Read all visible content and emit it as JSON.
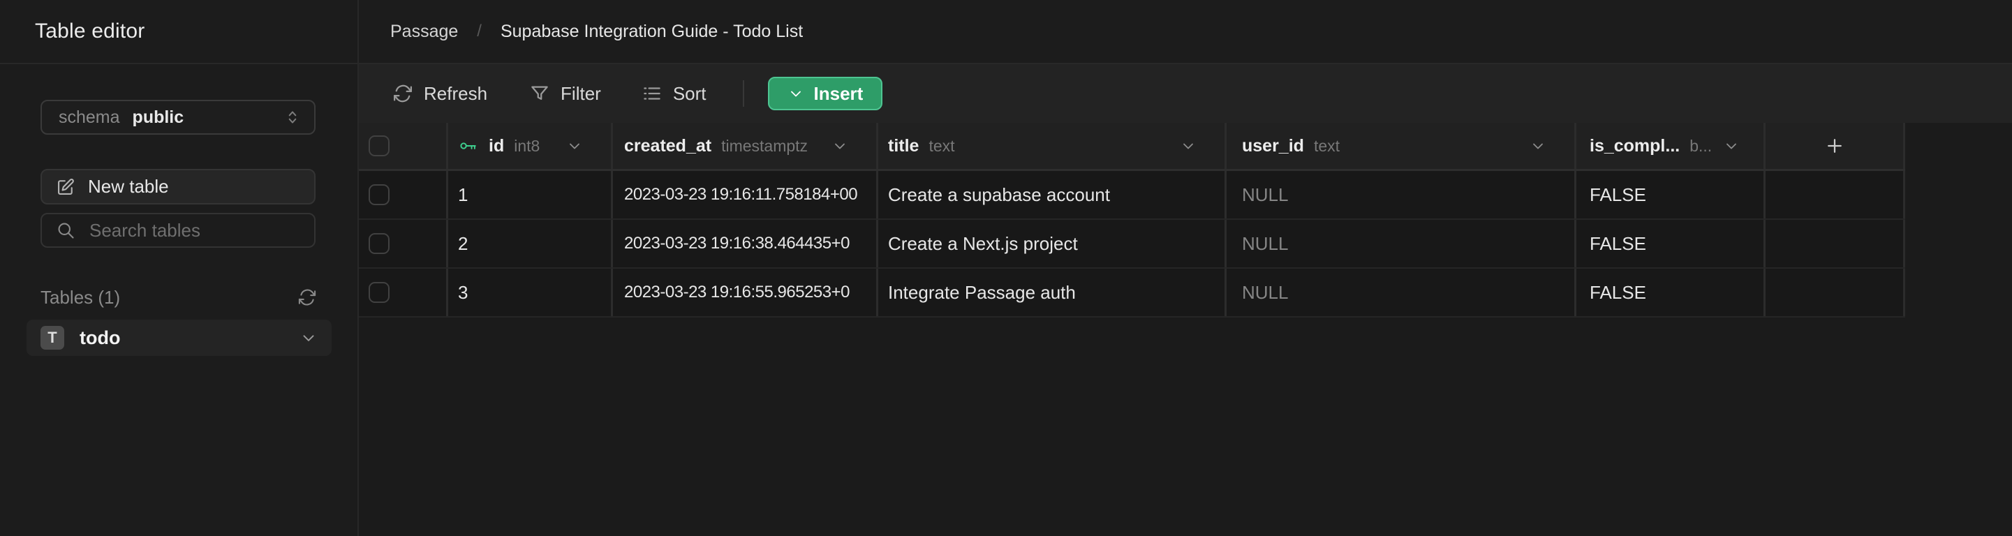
{
  "app": {
    "title": "Table editor"
  },
  "breadcrumb": {
    "project": "Passage",
    "separator": "/",
    "page": "Supabase Integration Guide - Todo List"
  },
  "sidebar": {
    "schema_label": "schema",
    "schema_value": "public",
    "new_table_label": "New table",
    "search_placeholder": "Search tables",
    "tables_heading": "Tables (1)",
    "tables": [
      {
        "badge": "T",
        "name": "todo"
      }
    ]
  },
  "toolbar": {
    "refresh_label": "Refresh",
    "filter_label": "Filter",
    "sort_label": "Sort",
    "insert_label": "Insert"
  },
  "grid": {
    "columns": {
      "id": {
        "name": "id",
        "type": "int8"
      },
      "created_at": {
        "name": "created_at",
        "type": "timestamptz"
      },
      "title": {
        "name": "title",
        "type": "text"
      },
      "user_id": {
        "name": "user_id",
        "type": "text"
      },
      "is_completed": {
        "name": "is_compl...",
        "type": "b..."
      }
    },
    "rows": [
      {
        "id": "1",
        "created_at": "2023-03-23 19:16:11.758184+00",
        "title": "Create a supabase account",
        "user_id": "NULL",
        "is_completed": "FALSE"
      },
      {
        "id": "2",
        "created_at": "2023-03-23 19:16:38.464435+0",
        "title": "Create a Next.js project",
        "user_id": "NULL",
        "is_completed": "FALSE"
      },
      {
        "id": "3",
        "created_at": "2023-03-23 19:16:55.965253+0",
        "title": "Integrate Passage auth",
        "user_id": "NULL",
        "is_completed": "FALSE"
      }
    ]
  },
  "colors": {
    "accent_green": "#3ecf8e",
    "insert_button_bg": "#2e9d68",
    "insert_button_border": "#4ec592",
    "page_bg": "#1b1b1b",
    "sidebar_bg": "#1c1c1c",
    "toolbar_bg": "#232323",
    "grid_header_bg": "#212121",
    "grid_row_bg": "#181818"
  }
}
